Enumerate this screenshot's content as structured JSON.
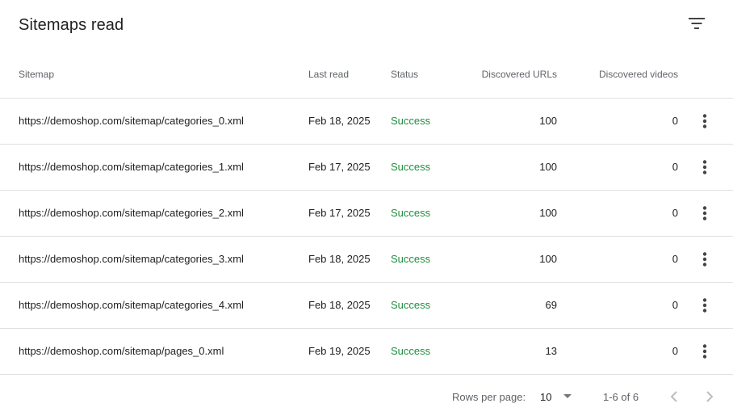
{
  "header": {
    "title": "Sitemaps read",
    "filter_icon": "filter-list-icon"
  },
  "table": {
    "columns": {
      "sitemap": "Sitemap",
      "last_read": "Last read",
      "status": "Status",
      "discovered_urls": "Discovered URLs",
      "discovered_videos": "Discovered videos"
    },
    "rows": [
      {
        "sitemap": "https://demoshop.com/sitemap/categories_0.xml",
        "last_read": "Feb 18, 2025",
        "status": "Success",
        "urls": "100",
        "videos": "0"
      },
      {
        "sitemap": "https://demoshop.com/sitemap/categories_1.xml",
        "last_read": "Feb 17, 2025",
        "status": "Success",
        "urls": "100",
        "videos": "0"
      },
      {
        "sitemap": "https://demoshop.com/sitemap/categories_2.xml",
        "last_read": "Feb 17, 2025",
        "status": "Success",
        "urls": "100",
        "videos": "0"
      },
      {
        "sitemap": "https://demoshop.com/sitemap/categories_3.xml",
        "last_read": "Feb 18, 2025",
        "status": "Success",
        "urls": "100",
        "videos": "0"
      },
      {
        "sitemap": "https://demoshop.com/sitemap/categories_4.xml",
        "last_read": "Feb 18, 2025",
        "status": "Success",
        "urls": "69",
        "videos": "0"
      },
      {
        "sitemap": "https://demoshop.com/sitemap/pages_0.xml",
        "last_read": "Feb 19, 2025",
        "status": "Success",
        "urls": "13",
        "videos": "0"
      }
    ],
    "row_menu_icon": "more-vert-icon"
  },
  "pagination": {
    "rows_per_page_label": "Rows per page:",
    "rows_per_page_value": "10",
    "range_label": "1-6 of 6",
    "prev_icon": "chevron-left-icon",
    "next_icon": "chevron-right-icon"
  },
  "colors": {
    "status_success": "#1e8e3e",
    "text_primary": "#202124",
    "text_secondary": "#5f6368",
    "divider": "#e0e0e0"
  }
}
